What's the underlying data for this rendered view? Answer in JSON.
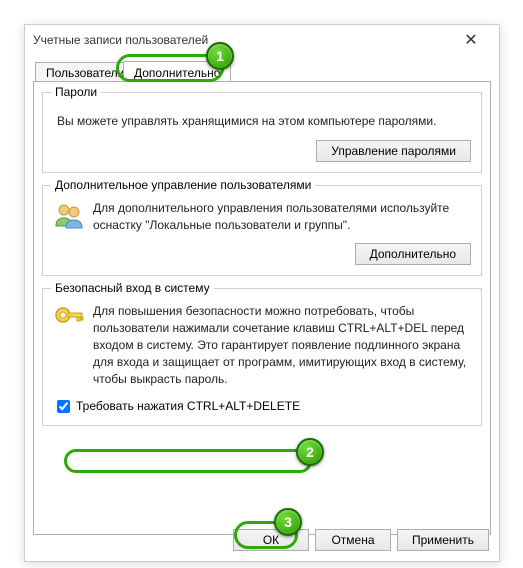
{
  "window": {
    "title": "Учетные записи пользователей"
  },
  "tabs": {
    "users": "Пользователи",
    "advanced": "Дополнительно"
  },
  "passwords": {
    "title": "Пароли",
    "text": "Вы можете управлять хранящимися на этом компьютере паролями.",
    "button": "Управление паролями"
  },
  "advUsers": {
    "title": "Дополнительное управление пользователями",
    "text": "Для дополнительного управления пользователями используйте оснастку \"Локальные пользователи и группы\".",
    "button": "Дополнительно"
  },
  "secure": {
    "title": "Безопасный вход в систему",
    "text": "Для повышения безопасности можно потребовать, чтобы пользователи нажимали сочетание клавиш CTRL+ALT+DEL перед входом в систему. Это гарантирует появление подлинного экрана для входа и защищает от программ, имитирующих вход в систему, чтобы выкрасть пароль.",
    "checkbox": "Требовать нажатия CTRL+ALT+DELETE"
  },
  "dialog": {
    "ok": "ОК",
    "cancel": "Отмена",
    "apply": "Применить"
  },
  "callouts": {
    "c1": "1",
    "c2": "2",
    "c3": "3"
  }
}
